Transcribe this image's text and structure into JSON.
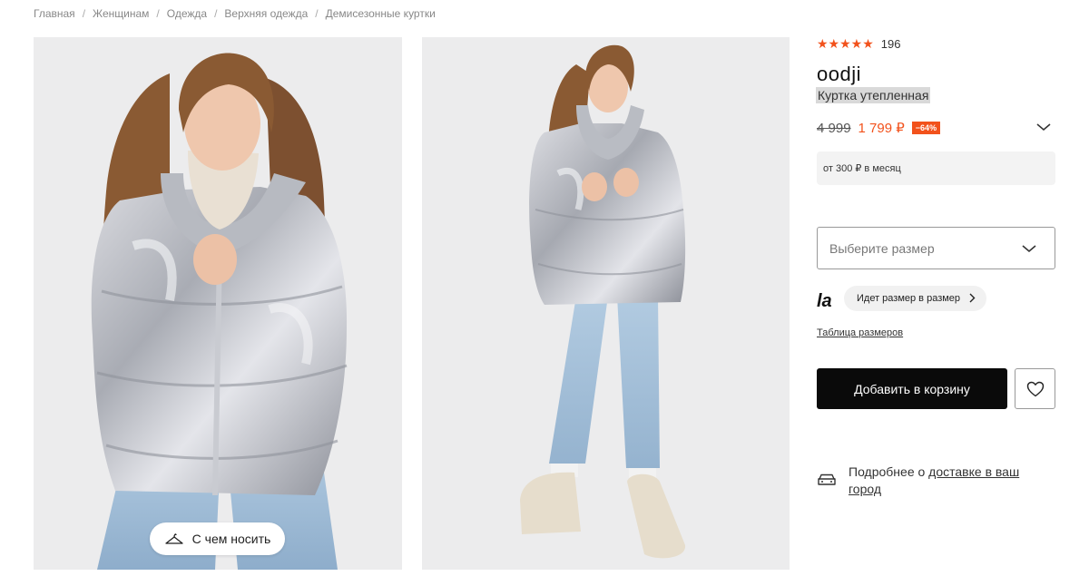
{
  "breadcrumb": [
    "Главная",
    "Женщинам",
    "Одежда",
    "Верхняя одежда",
    "Демисезонные куртки"
  ],
  "breadcrumb_sep": "/",
  "product": {
    "stars": "★★★★★",
    "rating_value": 5,
    "reviews_count": "196",
    "brand": "oodji",
    "name": "Куртка утепленная",
    "old_price": "4 999",
    "new_price": "1 799 ₽",
    "discount": "−64%",
    "installment": "от 300 ₽ в месяц"
  },
  "photos": {
    "outfit_button": "С чем носить"
  },
  "size": {
    "placeholder": "Выберите размер",
    "fit_badge": "la",
    "fit_note": "Идет размер в размер",
    "size_table": "Таблица размеров"
  },
  "actions": {
    "add_to_cart": "Добавить в корзину"
  },
  "delivery": {
    "prefix": "Подробнее о",
    "link": "доставке в ваш город"
  },
  "colors": {
    "accent": "#f2521c",
    "button_bg": "#0a0a0a",
    "photo_bg": "#ececed"
  },
  "icons": [
    "hanger-icon",
    "chevron-down-icon",
    "chevron-right-icon",
    "heart-icon",
    "truck-icon"
  ]
}
